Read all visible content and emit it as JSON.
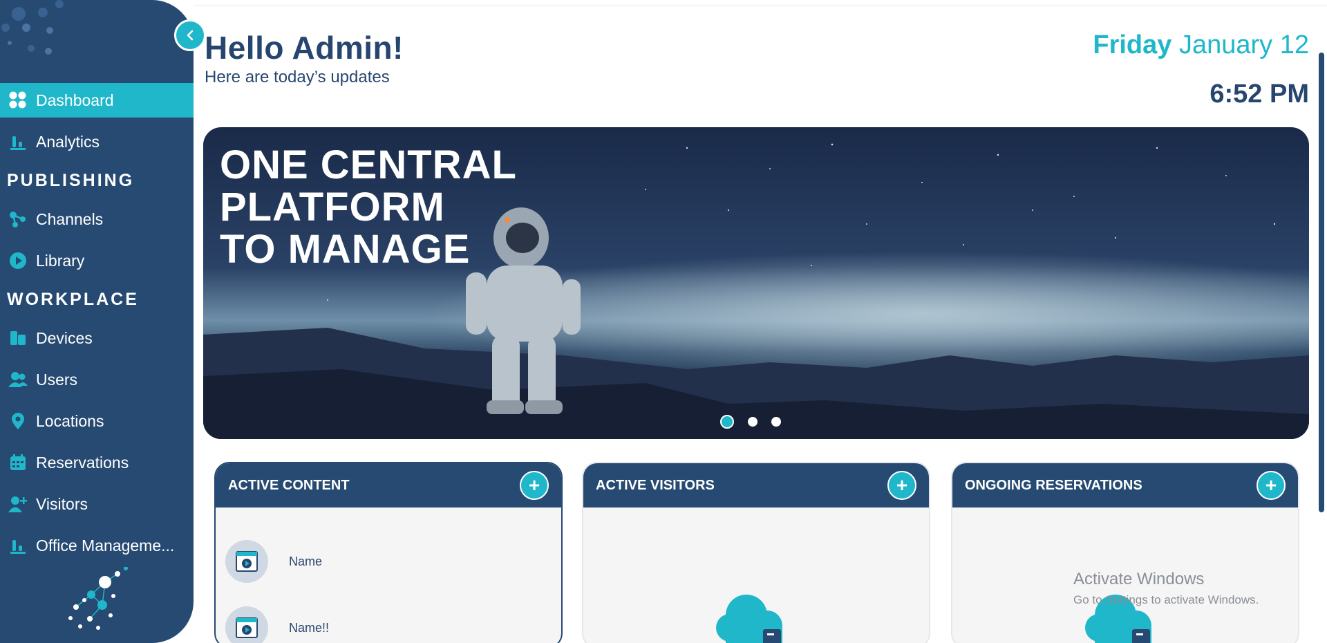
{
  "sidebar": {
    "nav_top": [
      {
        "label": "Dashboard",
        "icon": "grid-icon",
        "active": true
      },
      {
        "label": "Analytics",
        "icon": "bar-chart-icon"
      }
    ],
    "section_publishing": "PUBLISHING",
    "nav_publishing": [
      {
        "label": "Channels",
        "icon": "share-nodes-icon"
      },
      {
        "label": "Library",
        "icon": "play-circle-icon"
      }
    ],
    "section_workplace": "WORKPLACE",
    "nav_workplace": [
      {
        "label": "Devices",
        "icon": "devices-icon"
      },
      {
        "label": "Users",
        "icon": "users-icon"
      },
      {
        "label": "Locations",
        "icon": "map-pin-icon"
      },
      {
        "label": "Reservations",
        "icon": "calendar-icon"
      },
      {
        "label": "Visitors",
        "icon": "user-plus-icon"
      },
      {
        "label": "Office Manageme...",
        "icon": "bar-chart-icon"
      }
    ]
  },
  "header": {
    "greeting": "Hello Admin!",
    "subtitle": "Here are today’s updates",
    "day": "Friday",
    "date": "January 12",
    "time": "6:52 PM"
  },
  "banner": {
    "headline": "ONE CENTRAL\nPLATFORM\nTO MANAGE",
    "slide_count": 3,
    "active_slide": 1
  },
  "cards": [
    {
      "title": "ACTIVE CONTENT",
      "items": [
        {
          "name": "Name"
        },
        {
          "name": "Name!!"
        }
      ]
    },
    {
      "title": "ACTIVE VISITORS",
      "items": []
    },
    {
      "title": "ONGOING RESERVATIONS",
      "items": []
    }
  ],
  "watermark": {
    "line1": "Activate Windows",
    "line2": "Go to Settings to activate Windows."
  },
  "colors": {
    "navy": "#264a72",
    "accent": "#1fb7c9",
    "text": "#27466f"
  }
}
